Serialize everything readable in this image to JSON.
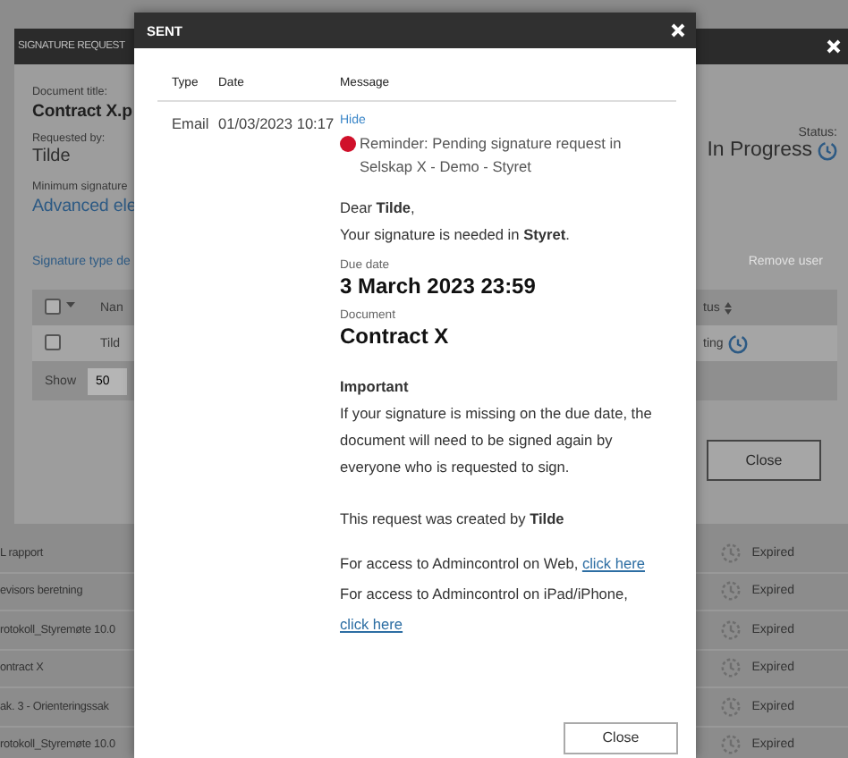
{
  "background_list": {
    "rows": [
      {
        "name": "L rapport",
        "status": "Expired"
      },
      {
        "name": "evisors beretning",
        "status": "Expired"
      },
      {
        "name": "rotokoll_Styremøte 10.0",
        "status": "Expired"
      },
      {
        "name": "ontract X",
        "status": "Expired"
      },
      {
        "name": "ak. 3 - Orienteringssak",
        "status": "Expired"
      },
      {
        "name": "rotokoll_Styremøte 10.0",
        "status": "Expired"
      }
    ]
  },
  "signature_request_dialog": {
    "title": "SIGNATURE REQUEST",
    "document_title_label": "Document title:",
    "document_title": "Contract X.p",
    "requested_by_label": "Requested by:",
    "requested_by": "Tilde",
    "minimum_signature_label": "Minimum signature",
    "minimum_signature": "Advanced ele",
    "status_label": "Status:",
    "status": "In Progress",
    "signature_type_link": "Signature type de",
    "remove_user_button": "Remove user",
    "table": {
      "header_checked": false,
      "columns": [
        "Nan",
        "tus"
      ],
      "rows": [
        {
          "checked": false,
          "cells": [
            "Tild",
            "ting"
          ]
        }
      ]
    },
    "show_label": "Show",
    "page_size": "50",
    "close_button": "Close"
  },
  "sent_dialog": {
    "title": "SENT",
    "columns": [
      "Type",
      "Date",
      "Message"
    ],
    "rows": [
      {
        "type": "Email",
        "date": "01/03/2023 10:17",
        "hide_link": "Hide",
        "subject": "Reminder: Pending signature request in Selskap X - Demo - Styret",
        "message": [
          {
            "kind": "greeting",
            "lines": [
              "Dear **Tilde**,",
              "Your signature is needed in **Styret**."
            ]
          },
          {
            "kind": "field",
            "label": "Due date",
            "value": "3 March 2023 23:59"
          },
          {
            "kind": "field",
            "label": "Document",
            "value": "Contract X"
          },
          {
            "kind": "notice",
            "heading": "Important",
            "text": "If your signature is missing on the due date, the document will need to be signed again by everyone who is requested to sign."
          },
          {
            "kind": "paragraph",
            "text": "This request was created by **Tilde**"
          },
          {
            "kind": "access",
            "text": "For access to Admincontrol on Web,",
            "link": "click here"
          },
          {
            "kind": "access",
            "text": "For access to Admincontrol on iPad/iPhone,",
            "link": "click here"
          }
        ]
      }
    ],
    "close_button": "Close"
  }
}
